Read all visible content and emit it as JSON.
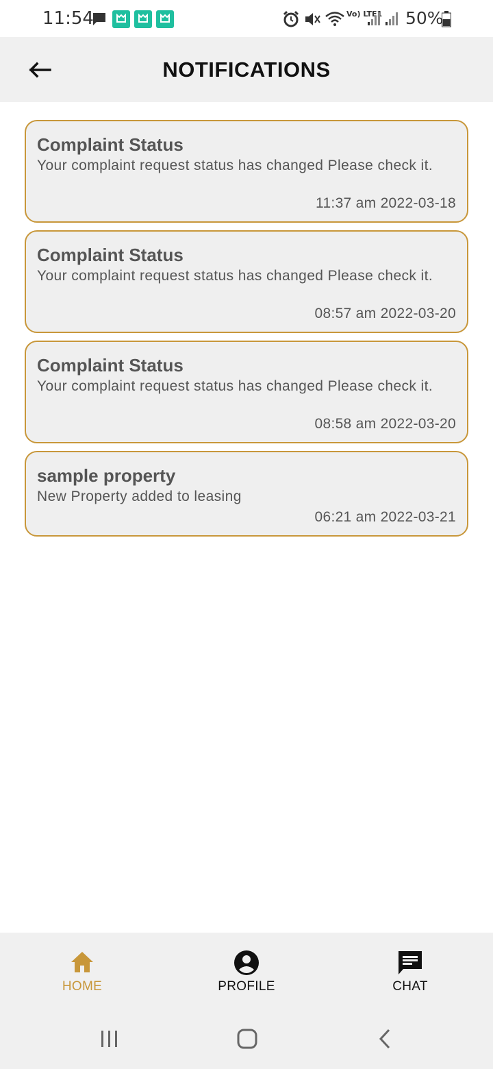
{
  "status_bar": {
    "time": "11:54",
    "battery": "50%",
    "network_label": "Vo) LTE1"
  },
  "header": {
    "title": "NOTIFICATIONS",
    "back_icon": "arrow-left-icon"
  },
  "notifications": [
    {
      "title": "Complaint Status",
      "body": "Your complaint request status has changed Please check it.",
      "time": "11:37 am 2022-03-18"
    },
    {
      "title": "Complaint Status",
      "body": "Your complaint request status has changed Please check it.",
      "time": "08:57 am 2022-03-20"
    },
    {
      "title": "Complaint Status",
      "body": "Your complaint request status has changed Please check it.",
      "time": "08:58 am 2022-03-20"
    },
    {
      "title": "sample property",
      "body": "New Property added to leasing",
      "time": "06:21 am 2022-03-21"
    }
  ],
  "bottom_nav": {
    "home": {
      "label": "HOME",
      "icon": "home-icon",
      "active": true
    },
    "profile": {
      "label": "PROFILE",
      "icon": "account-circle-icon",
      "active": false
    },
    "chat": {
      "label": "CHAT",
      "icon": "chat-icon",
      "active": false
    }
  },
  "colors": {
    "accent": "#c8973a",
    "card_bg": "#efefef",
    "header_bg": "#f0f0f0",
    "text": "#555555",
    "status_app": "#1fbf9f"
  }
}
